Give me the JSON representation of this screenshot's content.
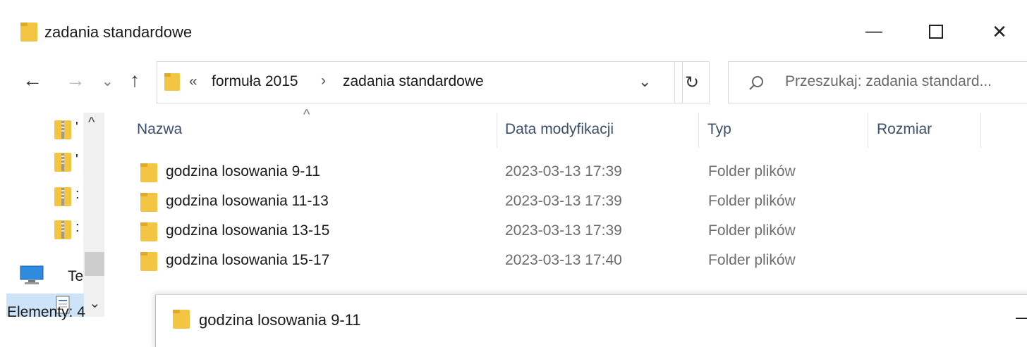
{
  "window": {
    "title": "zadania standardowe",
    "folder_icon_color": "#f4c542",
    "minimize_label": "—",
    "maximize_label": "☐",
    "close_label": "✕"
  },
  "nav": {
    "back_icon": "←",
    "forward_icon": "→",
    "recent_icon": "⌄",
    "up_icon": "↑",
    "overflow_marker": "«",
    "breadcrumbs": [
      {
        "label": "formuła 2015"
      },
      {
        "label": "zadania standardowe"
      }
    ],
    "separator": "›",
    "dropdown_icon": "⌄",
    "refresh_icon": "↻"
  },
  "search": {
    "placeholder": "Przeszukaj: zadania standard..."
  },
  "sidebar": {
    "items": [
      {
        "icon": "zip-folder-icon",
        "label": "'"
      },
      {
        "icon": "zip-folder-icon",
        "label": "'"
      },
      {
        "icon": "zip-folder-icon",
        "label": ":"
      },
      {
        "icon": "zip-folder-icon",
        "label": ":"
      },
      {
        "icon": "computer-icon",
        "label": "Te"
      },
      {
        "icon": "document-icon",
        "label": ""
      }
    ],
    "scroll_up": "^",
    "scroll_down": "⌄"
  },
  "columns": {
    "sort_indicator": "^",
    "name": "Nazwa",
    "date": "Data modyfikacji",
    "type": "Typ",
    "size": "Rozmiar"
  },
  "files": [
    {
      "name": "godzina losowania 9-11",
      "date": "2023-03-13 17:39",
      "type": "Folder plików"
    },
    {
      "name": "godzina losowania 11-13",
      "date": "2023-03-13 17:39",
      "type": "Folder plików"
    },
    {
      "name": "godzina losowania 13-15",
      "date": "2023-03-13 17:39",
      "type": "Folder plików"
    },
    {
      "name": "godzina losowania 15-17",
      "date": "2023-03-13 17:40",
      "type": "Folder plików"
    }
  ],
  "status": {
    "items_count": "Elementy: 4"
  },
  "second_window": {
    "title": "godzina losowania 9-11",
    "minimize_label": "—"
  }
}
